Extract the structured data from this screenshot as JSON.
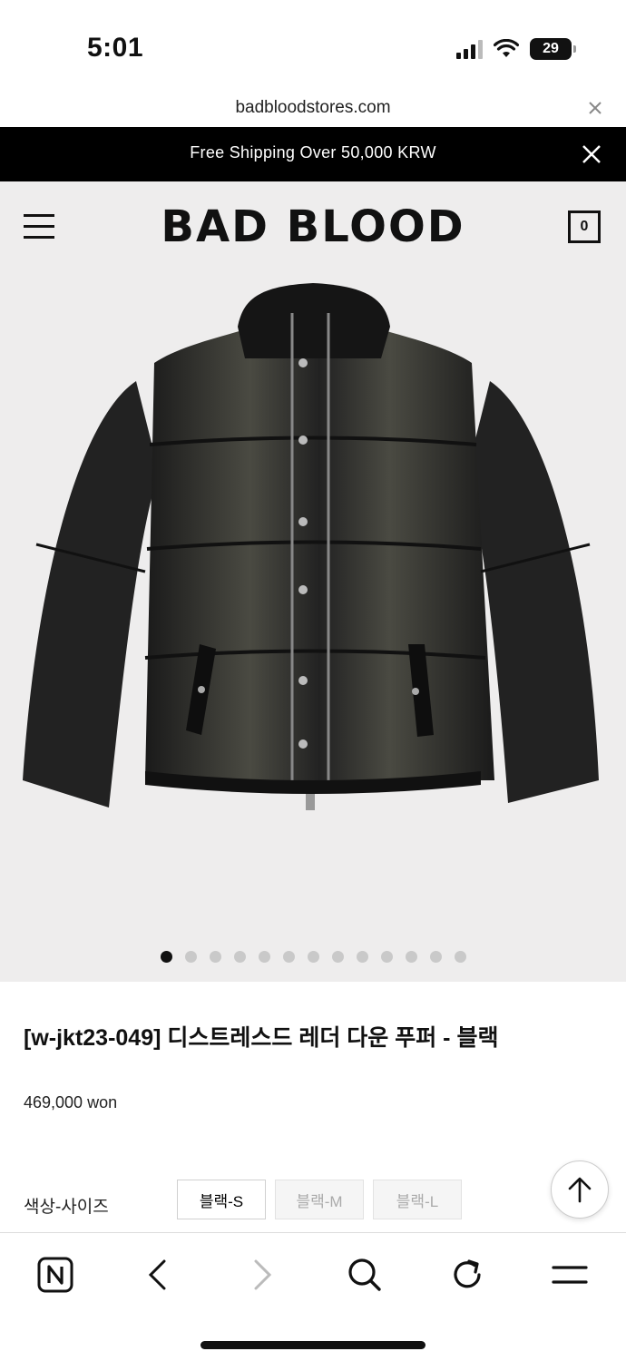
{
  "status_bar": {
    "time": "5:01",
    "battery": "29"
  },
  "browser": {
    "url": "badbloodstores.com"
  },
  "announcement": {
    "text": "Free Shipping Over 50,000 KRW"
  },
  "header": {
    "logo": "BAD BLOOD",
    "cart_count": "0"
  },
  "gallery": {
    "total_images": 13,
    "active_index": 0
  },
  "product": {
    "title": "[w-jkt23-049] 디스트레스드 레더 다운 푸퍼 - 블랙",
    "price": "469,000 won",
    "option_label": "색상-사이즈",
    "options": [
      {
        "label": "블랙-S",
        "available": true
      },
      {
        "label": "블랙-M",
        "available": false
      },
      {
        "label": "블랙-L",
        "available": false
      }
    ]
  },
  "icons": {
    "menu": "hamburger-icon",
    "cart": "shopping-bag-icon",
    "close": "close-icon",
    "scroll_top": "arrow-up-icon",
    "browser_home": "naver-n-icon",
    "back": "chevron-left-icon",
    "forward": "chevron-right-icon",
    "search": "search-icon",
    "reload": "reload-icon",
    "more": "menu-lines-icon"
  },
  "colors": {
    "header_bg": "#eeeded",
    "announce_bg": "#000000",
    "text": "#111111"
  }
}
